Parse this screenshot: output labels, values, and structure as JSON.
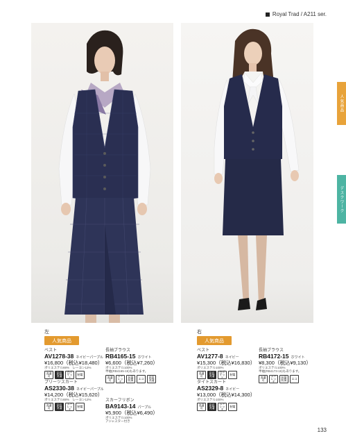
{
  "header": {
    "series": "Royal Trad / A211 ser."
  },
  "tabs": {
    "popular": "人気商品",
    "desk": "デスクワーク"
  },
  "photos": {
    "left_alt": "左のモデル写真",
    "right_alt": "右のモデル写真"
  },
  "left": {
    "label": "左",
    "badge": "人気商品",
    "products": [
      {
        "category": "ベスト",
        "code": "AV1278-38",
        "color": "ネイビーパープル",
        "price": "¥16,800（税込¥18,480）",
        "material": "ポリエステル88%　レーヨン12%"
      },
      {
        "category": "長袖ブラウス",
        "code": "RB4165-15",
        "color": "ホワイト",
        "price": "¥6,600（税込¥7,260）",
        "material": "ポリエステル100%",
        "note": "半袖(RB4165-15)もあります。"
      },
      {
        "category": "プリーツスカート",
        "code": "AS2330-38",
        "color": "ネイビーパープル",
        "price": "¥14,200（税込¥15,620）",
        "material": "ポリエステル88%　レーヨン12%"
      },
      {
        "category": "スカーフリボン",
        "code": "BA9143-14",
        "color": "パープル",
        "price": "¥5,900（税込¥6,490）",
        "material": "ポリエステル100%",
        "note": "アジャスター付き"
      }
    ]
  },
  "right": {
    "label": "右",
    "badge": "人気商品",
    "products": [
      {
        "category": "ベスト",
        "code": "AV1277-8",
        "color": "ネイビー",
        "price": "¥15,300（税込¥16,830）",
        "material": "ポリエステル100%"
      },
      {
        "category": "長袖ブラウス",
        "code": "RB4172-15",
        "color": "ホワイト",
        "price": "¥8,300（税込¥9,130）",
        "material": "ポリエステル100%",
        "note": "半袖(RB4173-15)もあります。"
      },
      {
        "category": "タイトスカート",
        "code": "AS2329-8",
        "color": "ネイビー",
        "price": "¥13,000（税込¥14,300）",
        "material": "ポリエステル100%"
      }
    ]
  },
  "icon_labels": {
    "wash": "洗濯可",
    "home": "家庭洗濯",
    "stretch": "ストレッチ",
    "eco": "エコ",
    "static": "制電",
    "antibac": "抗菌防臭",
    "pocket": "内ポケット"
  },
  "page": {
    "number": "133"
  },
  "colors": {
    "badge": "#e39a2f",
    "tab_popular": "#e8a33a",
    "tab_desk": "#4db4a3",
    "navy": "#2a2f52"
  }
}
